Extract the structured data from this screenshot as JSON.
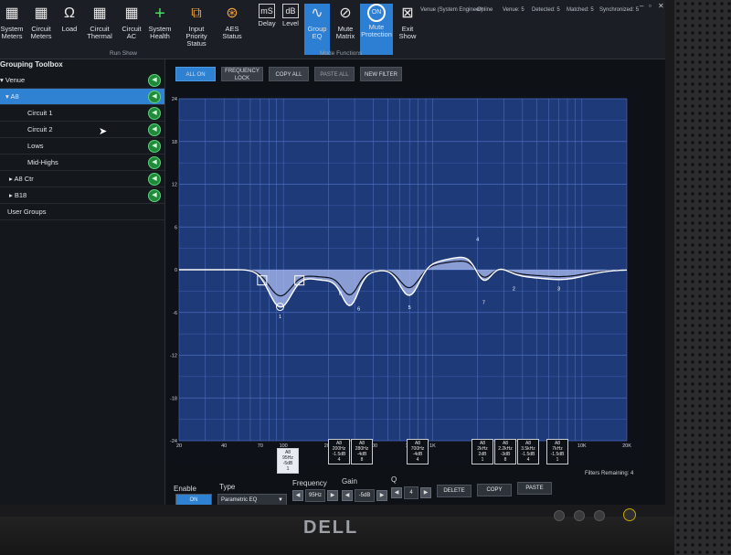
{
  "ribbon": {
    "buttons": [
      {
        "label": "System Meters",
        "icon": "meter-icon"
      },
      {
        "label": "Circuit Meters",
        "icon": "meter-icon"
      },
      {
        "label": "Load",
        "icon": "ohm-icon"
      },
      {
        "label": "Circuit Thermal",
        "icon": "grid-icon"
      },
      {
        "label": "Circuit AC",
        "icon": "grid-icon"
      },
      {
        "label": "System Health",
        "icon": "plus-icon"
      },
      {
        "label": "Input Priority Status",
        "icon": "input-priority-icon"
      },
      {
        "label": "AES Status",
        "icon": "xlr-icon"
      },
      {
        "label": "Delay",
        "icon": "ms-icon"
      },
      {
        "label": "Level",
        "icon": "db-icon"
      },
      {
        "label": "Group EQ",
        "icon": "eq-icon"
      },
      {
        "label": "Mute Matrix",
        "icon": "mute-icon"
      },
      {
        "label": "Mute Protection",
        "icon": "on-icon"
      },
      {
        "label": "Exit Show",
        "icon": "exit-icon"
      }
    ],
    "run_show_label": "Run Show",
    "mode_functions_label": "Mode Functions"
  },
  "status": {
    "venue": "Venue (System Engineer)",
    "online": "Online",
    "venue_count": "Venue: 5",
    "detected": "Detected: 5",
    "matched": "Matched: 5",
    "synchronized": "Synchronized: 5"
  },
  "sidebar": {
    "title": "Grouping Toolbox",
    "items": [
      {
        "label": "Venue",
        "prefix": "▾"
      },
      {
        "label": "A8",
        "prefix": "▾"
      },
      {
        "label": "Circuit 1",
        "prefix": ""
      },
      {
        "label": "Circuit 2",
        "prefix": ""
      },
      {
        "label": "Lows",
        "prefix": ""
      },
      {
        "label": "Mid-Highs",
        "prefix": ""
      },
      {
        "label": "A8 Ctr",
        "prefix": "▸"
      },
      {
        "label": "B18",
        "prefix": "▸"
      },
      {
        "label": "User Groups",
        "prefix": ""
      }
    ]
  },
  "toolbar": {
    "all_on": "ALL ON",
    "frequency_lock_1": "FREQUENCY",
    "frequency_lock_2": "LOCK",
    "copy_all": "COPY ALL",
    "paste_all": "PASTE ALL",
    "new_filter": "NEW FILTER"
  },
  "graph": {
    "y_ticks": [
      "24",
      "18",
      "12",
      "6",
      "0",
      "-6",
      "-12",
      "-18",
      "-24"
    ],
    "x_ticks": [
      "20",
      "40",
      "70",
      "100",
      "200",
      "400",
      "700",
      "1K",
      "2K",
      "4K",
      "7K",
      "10K",
      "20K"
    ],
    "markers": [
      "1",
      "8",
      "6",
      "5",
      "4",
      "7",
      "2",
      "3"
    ],
    "filter_labels": [
      {
        "l1": "A8",
        "l2": "95Hz",
        "l3": "-5dB",
        "l4": "1"
      },
      {
        "l1": "A8",
        "l2": "200Hz",
        "l3": "-1.5dB",
        "l4": "4"
      },
      {
        "l1": "A8",
        "l2": "280Hz",
        "l3": "-4dB",
        "l4": "8"
      },
      {
        "l1": "A8",
        "l2": "700Hz",
        "l3": "-4dB",
        "l4": "4"
      },
      {
        "l1": "A8",
        "l2": "2kHz",
        "l3": "2dB",
        "l4": "1"
      },
      {
        "l1": "A8",
        "l2": "2.2kHz",
        "l3": "-3dB",
        "l4": "8"
      },
      {
        "l1": "A8",
        "l2": "3.5kHz",
        "l3": "-1.5dB",
        "l4": "4"
      },
      {
        "l1": "A8",
        "l2": "7kHz",
        "l3": "-1.5dB",
        "l4": "1"
      }
    ]
  },
  "controls": {
    "enable_label": "Enable",
    "enable_value": "ON",
    "type_label": "Type",
    "type_value": "Parametric EQ",
    "frequency_label": "Frequency",
    "frequency_value": "95Hz",
    "gain_label": "Gain",
    "gain_value": "-5dB",
    "q_label": "Q",
    "q_value": "4",
    "delete": "DELETE",
    "copy": "COPY",
    "paste": "PASTE",
    "filters_remaining": "Filters Remaining: 4"
  },
  "monitor": {
    "brand": "DELL"
  }
}
